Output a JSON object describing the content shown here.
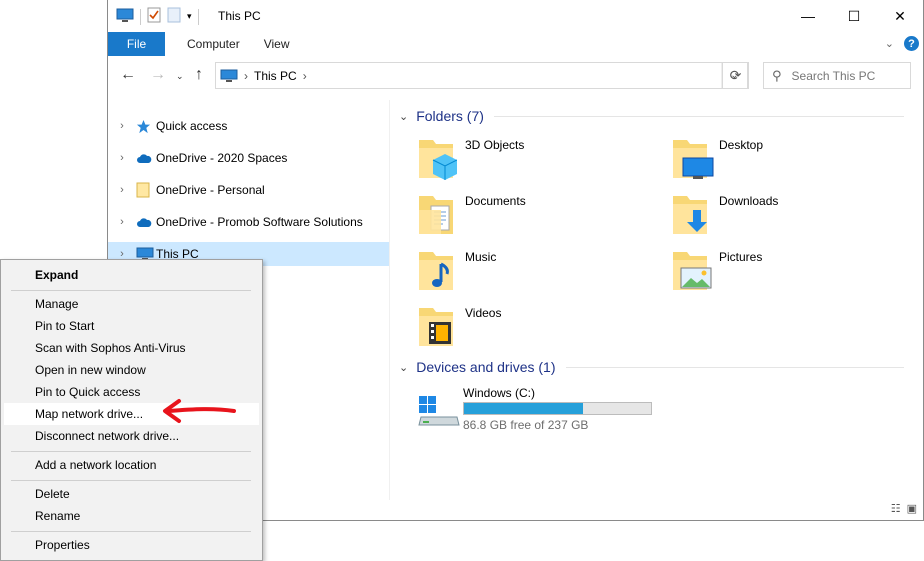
{
  "window": {
    "title": "This PC",
    "ribbon_tabs": [
      "File",
      "Computer",
      "View"
    ],
    "address_path": "This PC",
    "address_separator": "›",
    "search_placeholder": "Search This PC"
  },
  "nav_pane": {
    "items": [
      {
        "label": "Quick access",
        "icon": "star-icon"
      },
      {
        "label": "OneDrive - 2020 Spaces",
        "icon": "cloud-icon"
      },
      {
        "label": "OneDrive - Personal",
        "icon": "folder-icon"
      },
      {
        "label": "OneDrive - Promob Software Solutions",
        "icon": "cloud-icon"
      },
      {
        "label": "This PC",
        "icon": "computer-icon",
        "selected": true
      }
    ]
  },
  "content": {
    "folders_header": "Folders (7)",
    "folders": [
      {
        "label": "3D Objects",
        "icon": "3d-objects-folder-icon"
      },
      {
        "label": "Desktop",
        "icon": "desktop-folder-icon"
      },
      {
        "label": "Documents",
        "icon": "documents-folder-icon"
      },
      {
        "label": "Downloads",
        "icon": "downloads-folder-icon"
      },
      {
        "label": "Music",
        "icon": "music-folder-icon"
      },
      {
        "label": "Pictures",
        "icon": "pictures-folder-icon"
      },
      {
        "label": "Videos",
        "icon": "videos-folder-icon"
      }
    ],
    "drives_header": "Devices and drives (1)",
    "drive": {
      "label": "Windows (C:)",
      "free_text": "86.8 GB free of 237 GB",
      "used_fraction": 0.634,
      "bar_color": "#26a0da"
    }
  },
  "context_menu": {
    "items": [
      {
        "label": "Expand",
        "bold": true
      },
      {
        "label": "Manage"
      },
      {
        "label": "Pin to Start"
      },
      {
        "label": "Scan with Sophos Anti-Virus"
      },
      {
        "label": "Open in new window"
      },
      {
        "label": "Pin to Quick access"
      },
      {
        "label": "Map network drive...",
        "highlighted": true
      },
      {
        "label": "Disconnect network drive..."
      },
      {
        "label": "Add a network location"
      },
      {
        "label": "Delete"
      },
      {
        "label": "Rename"
      },
      {
        "label": "Properties"
      }
    ],
    "annotation_arrow_color": "#e8141c"
  },
  "colors": {
    "accent": "#1979ca",
    "selection": "#cce8ff",
    "group_header": "#1e3287"
  }
}
